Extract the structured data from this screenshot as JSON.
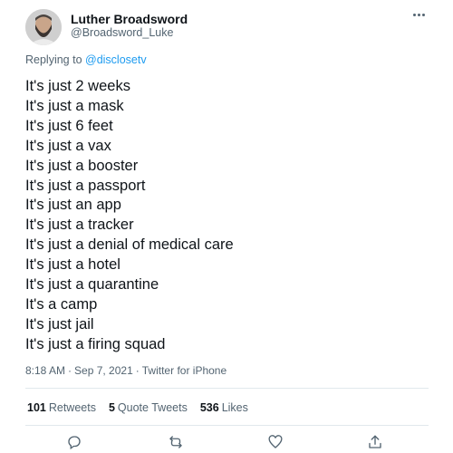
{
  "tweet": {
    "author_name": "Luther Broadsword",
    "author_handle": "@Broadsword_Luke",
    "reply_prefix": "Replying to ",
    "reply_mention": "@disclosetv",
    "lines": [
      "It's just 2 weeks",
      "It's just a mask",
      "It's just 6 feet",
      "It's just a vax",
      "It's just a booster",
      "It's just a passport",
      "It's just an app",
      "It's just a tracker",
      "It's just a denial of medical care",
      "It's just a hotel",
      "It's just a quarantine",
      "It's a camp",
      "It's just jail",
      "It's just a firing squad"
    ],
    "time": "8:18 AM",
    "date": "Sep 7, 2021",
    "client": "Twitter for iPhone",
    "separator": "·"
  },
  "stats": {
    "retweets_count": "101",
    "retweets_label": "Retweets",
    "quotes_count": "5",
    "quotes_label": "Quote Tweets",
    "likes_count": "536",
    "likes_label": "Likes"
  },
  "icons": {
    "more": "more-icon",
    "reply": "reply-icon",
    "retweet": "retweet-icon",
    "like": "like-icon",
    "share": "share-icon"
  },
  "colors": {
    "text": "#0f1419",
    "secondary": "#536471",
    "link": "#1d9bf0",
    "divider": "#e1e8ed"
  }
}
